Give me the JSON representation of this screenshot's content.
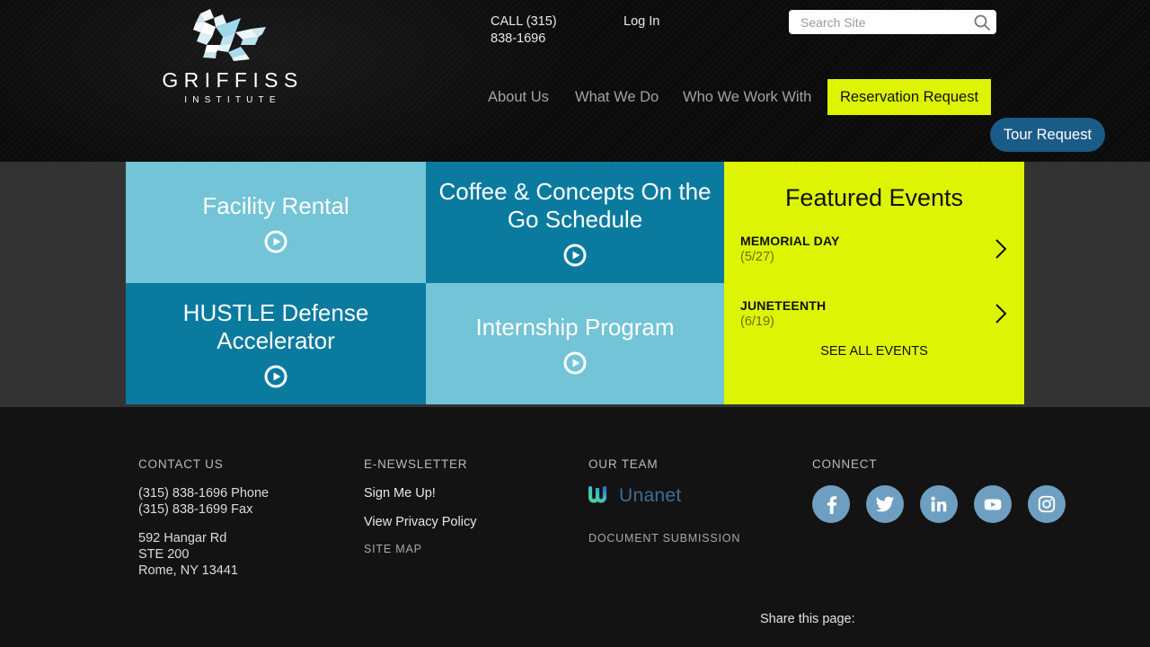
{
  "header": {
    "logo": {
      "word": "GRIFFISS",
      "sub": "INSTITUTE",
      "mark_icon": "origami-griffin-logo"
    },
    "call_label": "CALL (315) 838-1696",
    "login_label": "Log In",
    "search": {
      "placeholder": "Search Site",
      "value": "",
      "icon": "search-icon"
    },
    "nav": [
      {
        "label": "About Us"
      },
      {
        "label": "What We Do"
      },
      {
        "label": "Who We Work With"
      }
    ],
    "nav_cta": "Reservation Request",
    "tour_button": "Tour Request",
    "colors": {
      "accent_yellow": "#ddf505",
      "tour_blue": "#1b5b87",
      "bar_black": "#0b0b0b"
    }
  },
  "tiles": [
    {
      "title": "Facility Rental",
      "icon": "play-icon",
      "color": "#72c4d6"
    },
    {
      "title": "Coffee & Concepts On the Go Schedule",
      "icon": "play-icon",
      "color": "#0a7b9f"
    },
    {
      "title": "HUSTLE Defense Accelerator",
      "icon": "play-icon",
      "color": "#0a7b9f"
    },
    {
      "title": "Internship Program",
      "icon": "play-icon",
      "color": "#72c4d6"
    }
  ],
  "events": {
    "title": "Featured Events",
    "items": [
      {
        "name": "MEMORIAL DAY",
        "date": "(5/27)",
        "icon": "chevron-right-icon"
      },
      {
        "name": "JUNETEENTH",
        "date": "(6/19)",
        "icon": "chevron-right-icon"
      }
    ],
    "see_all": "SEE ALL EVENTS",
    "background": "#ddf505"
  },
  "footer": {
    "contact": {
      "heading": "CONTACT US",
      "phone": "(315) 838-1696 Phone",
      "fax": "(315) 838-1699 Fax",
      "address1": "592 Hangar Rd",
      "address2": "STE 200",
      "address3": "Rome, NY 13441"
    },
    "newsletter": {
      "heading": "E-NEWSLETTER",
      "signup": "Sign Me Up!",
      "privacy": "View Privacy Policy",
      "sitemap": "SITE MAP"
    },
    "team": {
      "heading": "OUR TEAM",
      "partner": "Unanet",
      "partner_icon": "unanet-logo",
      "document_submission": "DOCUMENT SUBMISSION"
    },
    "connect": {
      "heading": "CONNECT",
      "socials": [
        {
          "name": "facebook-icon",
          "label": "Facebook"
        },
        {
          "name": "twitter-icon",
          "label": "Twitter"
        },
        {
          "name": "linkedin-icon",
          "label": "LinkedIn"
        },
        {
          "name": "youtube-icon",
          "label": "YouTube"
        },
        {
          "name": "instagram-icon",
          "label": "Instagram"
        }
      ]
    },
    "share_label": "Share this page:"
  }
}
